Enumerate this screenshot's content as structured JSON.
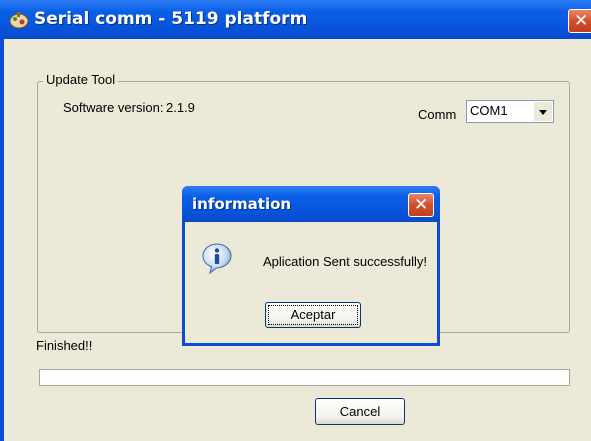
{
  "window": {
    "title": "Serial comm - 5119 platform",
    "close_glyph": "✕",
    "icon": "app-icon"
  },
  "update_tool": {
    "group_title": "Update Tool",
    "software_version_label": "Software version:",
    "software_version_value": "2.1.9",
    "comm_label": "Comm",
    "comm_selected": "COM1"
  },
  "status": {
    "text": "Finished!!",
    "progress": 0
  },
  "buttons": {
    "cancel": "Cancel"
  },
  "dialog": {
    "title": "information",
    "close_glyph": "✕",
    "message": "Aplication Sent successfully!",
    "ok_label": "Aceptar",
    "icon": "info-icon"
  },
  "colors": {
    "titlebar": "#0754dc",
    "close": "#d3502d",
    "window_bg": "#ece9d8"
  }
}
